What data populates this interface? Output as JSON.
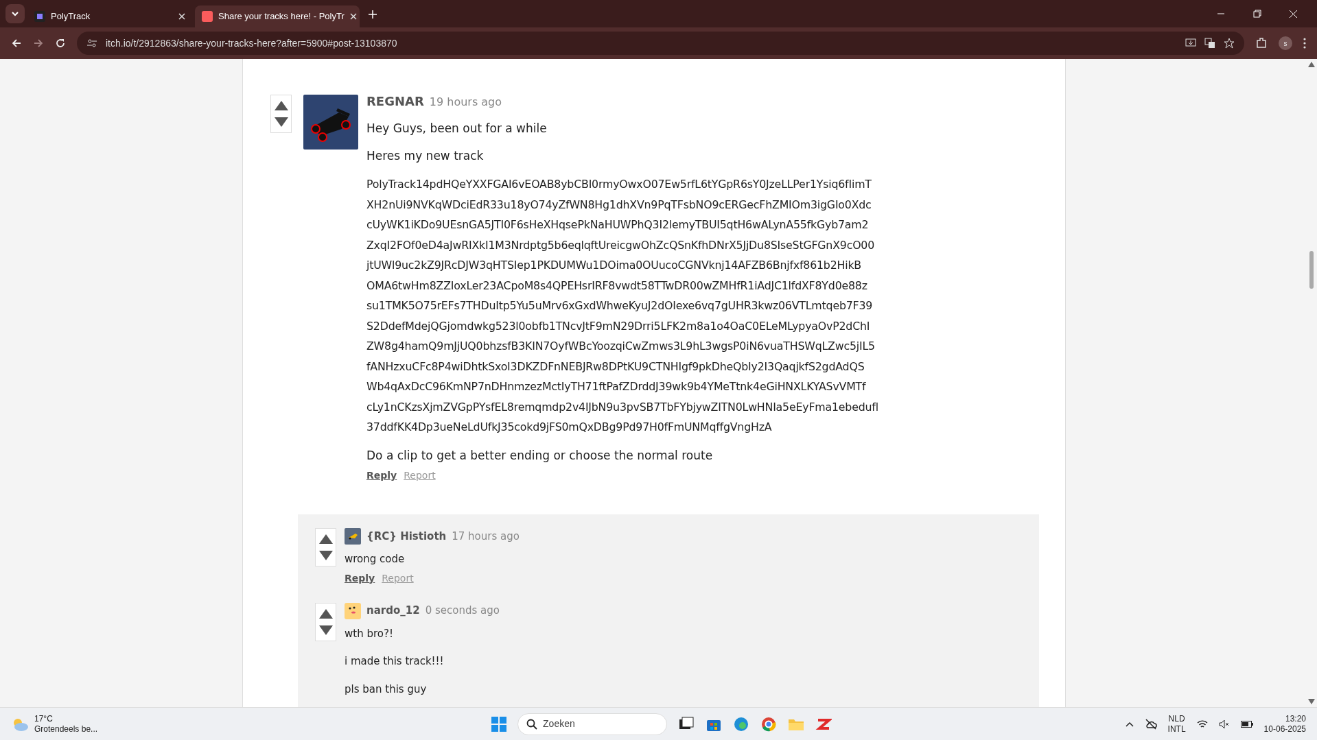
{
  "browser": {
    "tabs": [
      {
        "title": "PolyTrack",
        "selected": false
      },
      {
        "title": "Share your tracks here! - PolyTr",
        "selected": true
      }
    ],
    "url": "itch.io/t/2912863/share-your-tracks-here?after=5900#post-13103870",
    "profile_initial": "s"
  },
  "post": {
    "author": "REGNAR",
    "time": "19 hours ago",
    "paragraphs": [
      "Hey Guys, been out for a while",
      "Heres my new track"
    ],
    "code_lines": [
      "PolyTrack14pdHQeYXXFGAI6vEOAB8ybCBI0rmyOwxO07Ew5rfL6tYGpR6sY0JzeLLPer1Ysiq6fIimT",
      "XH2nUi9NVKqWDciEdR33u18yO74yZfWN8Hg1dhXVn9PqTFsbNO9cERGecFhZMIOm3igGIo0Xdc",
      "cUyWK1iKDo9UEsnGA5JTI0F6sHeXHqsePkNaHUWPhQ3I2lemyTBUI5qtH6wALynA55fkGyb7am2",
      "ZxqI2FOf0eD4aJwRIXkI1M3Nrdptg5b6eqlqftUreicgwOhZcQSnKfhDNrX5JjDu8SIseStGFGnX9cO00",
      "jtUWl9uc2kZ9JRcDJW3qHTSIep1PKDUMWu1DOima0OUucoCGNVknj14AFZB6Bnjfxf861b2HikB",
      "OMA6twHm8ZZIoxLer23ACpoM8s4QPEHsrIRF8vwdt58TTwDR00wZMHfR1iAdJC1lfdXF8Yd0e88z",
      "su1TMK5O75rEFs7THDuItp5Yu5uMrv6xGxdWhweKyuJ2dOIexe6vq7gUHR3kwz06VTLmtqeb7F39",
      "S2DdefMdejQGjomdwkg523l0obfb1TNcvJtF9mN29Drri5LFK2m8a1o4OaC0ELeMLypyaOvP2dChI",
      "ZW8g4hamQ9mJjUQ0bhzsfB3KIN7OyfWBcYoozqiCwZmws3L9hL3wgsP0iN6vuaTHSWqLZwc5jIL5",
      "fANHzxuCFc8P4wiDhtkSxoI3DKZDFnNEBJRw8DPtKU9CTNHIgf9pkDheQbIy2I3QaqjkfS2gdAdQS",
      "Wb4qAxDcC96KmNP7nDHnmzezMctIyTH71ftPafZDrddJ39wk9b4YMeTtnk4eGiHNXLKYASvVMTf",
      "cLy1nCKzsXjmZVGpPYsfEL8remqmdp2v4IJbN9u3pvSB7TbFYbjywZITN0LwHNIa5eEyFma1ebedufl",
      "37ddfKK4Dp3ueNeLdUfkJ35cokd9jFS0mQxDBg9Pd97H0fFmUNMqffgVngHzA"
    ],
    "closing": "Do a clip to get a better ending or choose the normal route",
    "actions": [
      "Reply",
      "Report"
    ]
  },
  "replies": [
    {
      "author": "{RC} Histioth",
      "time": "17 hours ago",
      "paragraphs": [
        "wrong code"
      ],
      "actions": [
        "Reply",
        "Report"
      ]
    },
    {
      "author": "nardo_12",
      "time": "0 seconds ago",
      "paragraphs": [
        "wth bro?!",
        "i made this track!!!",
        "pls ban this guy"
      ]
    }
  ],
  "taskbar": {
    "temperature": "17°C",
    "weather": "Grotendeels be...",
    "search_placeholder": "Zoeken",
    "language": "NLD",
    "layout": "INTL",
    "time": "13:20",
    "date": "10-06-2025"
  }
}
